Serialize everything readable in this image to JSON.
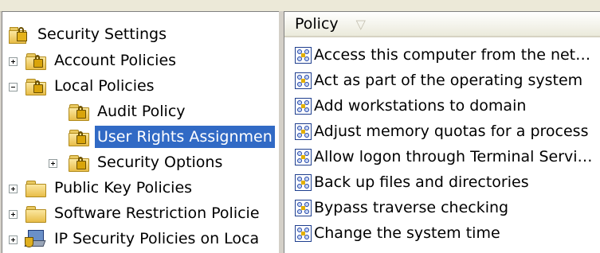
{
  "tree": {
    "root": {
      "label": "Security Settings"
    },
    "items": [
      {
        "label": "Account Policies",
        "expander": "+"
      },
      {
        "label": "Local Policies",
        "expander": "-"
      },
      {
        "label": "Audit Policy"
      },
      {
        "label": "User Rights Assignmen",
        "selected": true
      },
      {
        "label": "Security Options",
        "expander": "+"
      },
      {
        "label": "Public Key Policies",
        "expander": "+"
      },
      {
        "label": "Software Restriction Policie",
        "expander": "+"
      },
      {
        "label": "IP Security Policies on Loca",
        "expander": "+"
      }
    ]
  },
  "list": {
    "column_header": "Policy",
    "sort_indicator": "▽",
    "rows": [
      "Access this computer from the net…",
      "Act as part of the operating system",
      "Add workstations to domain",
      "Adjust memory quotas for a process",
      "Allow logon through Terminal Servi…",
      "Back up files and directories",
      "Bypass traverse checking",
      "Change the system time"
    ]
  },
  "colors": {
    "selection": "#316ac5",
    "pane_background": "#ffffff",
    "chrome": "#d4d0c8"
  }
}
